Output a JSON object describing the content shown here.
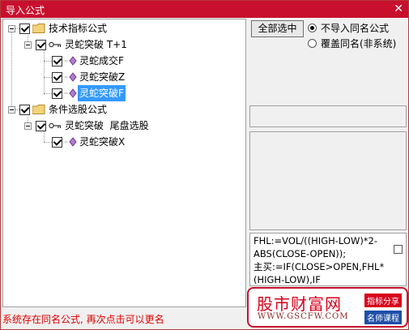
{
  "window": {
    "title": "导入公式",
    "close_glyph": "✕"
  },
  "tree": {
    "groups": [
      {
        "label": "技术指标公式",
        "children": [
          {
            "label": "灵蛇突破 T+1",
            "children": [
              {
                "label": "灵蛇成交F"
              },
              {
                "label": "灵蛇突破Z"
              },
              {
                "label": "灵蛇突破F",
                "selected": true
              }
            ]
          }
        ]
      },
      {
        "label": "条件选股公式",
        "children": [
          {
            "label": "灵蛇突破  尾盘选股",
            "children": [
              {
                "label": "灵蛇突破X"
              }
            ]
          }
        ]
      }
    ]
  },
  "controls": {
    "select_all": "全部选中",
    "radio_no_import": "不导入同名公式",
    "radio_overwrite": "覆盖同名(非系统)"
  },
  "code_text": "FHL:=VOL/((HIGH-LOW)*2-ABS(CLOSE-OPEN));\n主买:=IF(CLOSE>OPEN,FHL*(HIGH-LOW),IF",
  "status_text": "系统存在同名公式, 再次点击可以更名",
  "watermark": {
    "title": "股市财富网",
    "url": "WWW.GSCFW.COM",
    "tag1": "指标分享",
    "tag2": "名师课程"
  },
  "colors": {
    "titlebar": "#c8102e",
    "selection": "#3399ff",
    "status": "#e00000"
  }
}
